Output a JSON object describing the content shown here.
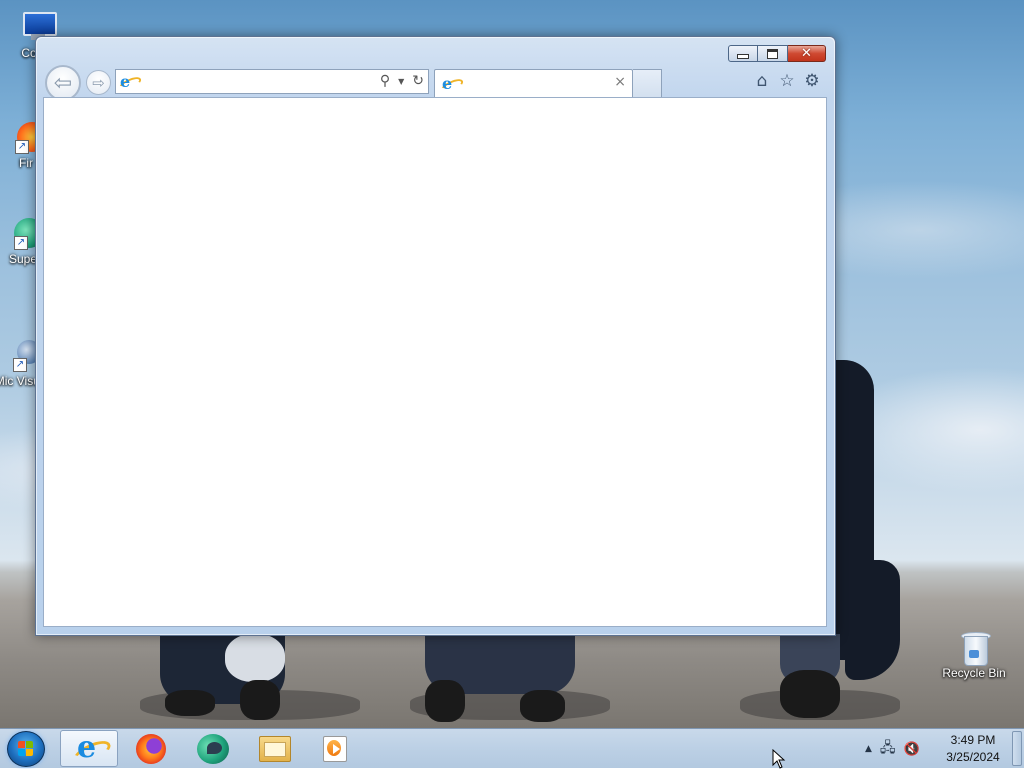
{
  "desktop": {
    "icons": [
      {
        "label": "Com",
        "name": "computer"
      },
      {
        "label": "Fir",
        "name": "firefox"
      },
      {
        "label": "Supe",
        "name": "supercopy"
      },
      {
        "label": "Mic Visual",
        "name": "microsoft-visual"
      }
    ],
    "recycle_bin_label": "Recycle Bin"
  },
  "browser": {
    "address": {
      "value": "",
      "placeholder": ""
    },
    "tab": {
      "title": "",
      "close_glyph": "×"
    },
    "icons": {
      "back": "back-arrow-icon",
      "forward": "forward-arrow-icon",
      "search": "search-icon",
      "refresh": "refresh-icon",
      "home": "home-icon",
      "favorites": "star-icon",
      "settings": "gear-icon"
    }
  },
  "taskbar": {
    "items": [
      "internet-explorer",
      "firefox",
      "supercopy",
      "file-explorer",
      "windows-media-player"
    ],
    "clock": {
      "time": "3:49 PM",
      "date": "3/25/2024"
    }
  },
  "colors": {
    "close_button": "#cf4a32",
    "ie_blue": "#1d8de0",
    "ie_ring": "#f0b428"
  }
}
